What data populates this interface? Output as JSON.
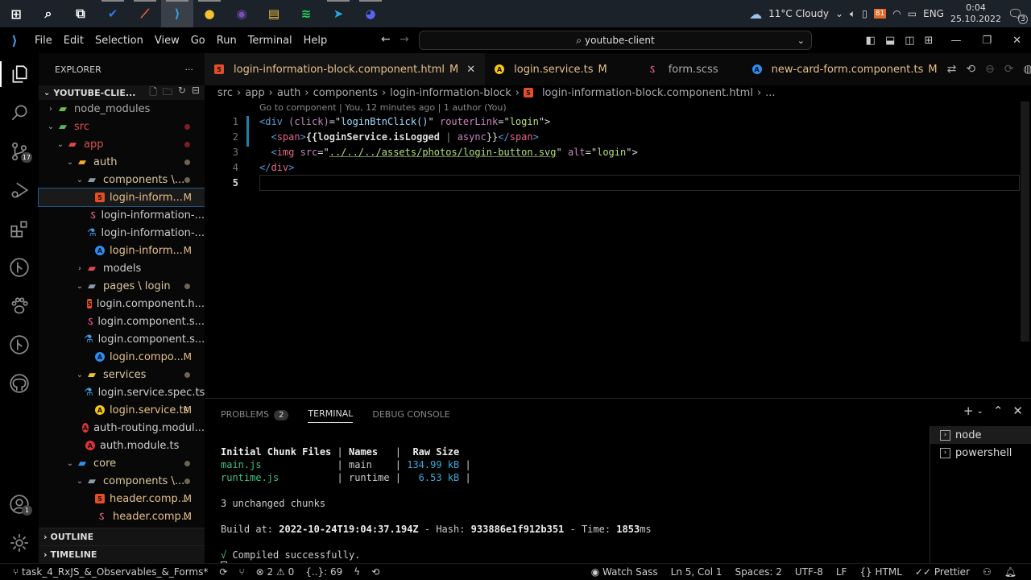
{
  "taskbar": {
    "apps": [
      {
        "name": "windows-start",
        "glyph": "⊞",
        "color": "#ffffff"
      },
      {
        "name": "search",
        "glyph": "⌕",
        "color": "#ffffff"
      },
      {
        "name": "task-view",
        "glyph": "⧉",
        "color": "#ffffff"
      },
      {
        "name": "todo",
        "glyph": "✔",
        "color": "#2a7de1"
      },
      {
        "name": "postman",
        "glyph": "⟋",
        "color": "#f26b3a"
      },
      {
        "name": "vscode",
        "glyph": "⟩",
        "color": "#3aa0f0"
      },
      {
        "name": "chrome",
        "glyph": "●",
        "color": "#f2c230"
      },
      {
        "name": "github-desktop",
        "glyph": "◉",
        "color": "#7a4fb5"
      },
      {
        "name": "file-explorer",
        "glyph": "▤",
        "color": "#f3c540"
      },
      {
        "name": "spotify",
        "glyph": "≋",
        "color": "#1ed760"
      },
      {
        "name": "telegram",
        "glyph": "➤",
        "color": "#2aa3df"
      },
      {
        "name": "discord",
        "glyph": "◕",
        "color": "#5865f2"
      }
    ],
    "weather": "11°C  Cloudy",
    "language": "ENG",
    "time": "0:04",
    "date": "25.10.2022",
    "notifications": "3",
    "battery_badge": "81"
  },
  "titlebar": {
    "menu": [
      "File",
      "Edit",
      "Selection",
      "View",
      "Go",
      "Run",
      "Terminal",
      "Help"
    ],
    "search": "youtube-client"
  },
  "activity_bar": {
    "source_control_badge": "17",
    "accounts_badge": "1"
  },
  "explorer": {
    "title": "EXPLORER",
    "more": "···",
    "project": "YOUTUBE-CLIE...",
    "tree": [
      {
        "label": "node_modules",
        "depth": 1,
        "chev": "›",
        "icon": "folder",
        "icolor": "#6cbf43",
        "tcolor": "#aaa"
      },
      {
        "label": "src",
        "depth": 1,
        "chev": "⌄",
        "icon": "folder",
        "icolor": "#58b35a",
        "tcolor": "#d8534f",
        "dot": "#7a1f24"
      },
      {
        "label": "app",
        "depth": 2,
        "chev": "⌄",
        "icon": "folder",
        "icolor": "#e0474c",
        "tcolor": "#d8534f",
        "dot": "#7a1f24"
      },
      {
        "label": "auth",
        "depth": 3,
        "chev": "⌄",
        "icon": "folder",
        "icolor": "#f0a72a",
        "tcolor": "#d9c8a0",
        "dot": "#6e6450"
      },
      {
        "label": "components \\...",
        "depth": 4,
        "chev": "⌄",
        "icon": "folder",
        "icolor": "#8a9aa8",
        "tcolor": "#d9c8a0",
        "dot": "#6e6450"
      },
      {
        "label": "login-inform...",
        "depth": 5,
        "icon": "html",
        "icolor": "#e44d26",
        "tcolor": "#e6c08a",
        "flag": "M",
        "selected": true
      },
      {
        "label": "login-information-...",
        "depth": 5,
        "icon": "scss",
        "icolor": "#e0568a",
        "tcolor": "#ccc"
      },
      {
        "label": "login-information-...",
        "depth": 5,
        "icon": "spec",
        "icolor": "#3d9be0",
        "tcolor": "#ccc"
      },
      {
        "label": "login-inform...",
        "depth": 5,
        "icon": "angular-blue",
        "icolor": "#2d8cf0",
        "tcolor": "#e6c08a",
        "flag": "M"
      },
      {
        "label": "models",
        "depth": 4,
        "chev": "›",
        "icon": "folder",
        "icolor": "#e0474c",
        "tcolor": "#ccc"
      },
      {
        "label": "pages \\ login",
        "depth": 4,
        "chev": "⌄",
        "icon": "folder",
        "icolor": "#8a9aa8",
        "tcolor": "#d9c8a0",
        "dot": "#6e6450"
      },
      {
        "label": "login.component.h...",
        "depth": 5,
        "icon": "html",
        "icolor": "#e44d26",
        "tcolor": "#ccc"
      },
      {
        "label": "login.component.s...",
        "depth": 5,
        "icon": "scss",
        "icolor": "#e0568a",
        "tcolor": "#ccc"
      },
      {
        "label": "login.component.s...",
        "depth": 5,
        "icon": "spec",
        "icolor": "#3d9be0",
        "tcolor": "#ccc"
      },
      {
        "label": "login.compo...",
        "depth": 5,
        "icon": "angular-blue",
        "icolor": "#2d8cf0",
        "tcolor": "#e6c08a",
        "flag": "M"
      },
      {
        "label": "services",
        "depth": 4,
        "chev": "⌄",
        "icon": "folder",
        "icolor": "#f0c030",
        "tcolor": "#d9c8a0",
        "dot": "#6e6450"
      },
      {
        "label": "login.service.spec.ts",
        "depth": 5,
        "icon": "spec",
        "icolor": "#3d9be0",
        "tcolor": "#ccc"
      },
      {
        "label": "login.service.ts",
        "depth": 5,
        "icon": "angular-yellow",
        "icolor": "#f5c518",
        "tcolor": "#e6c08a",
        "flag": "M"
      },
      {
        "label": "auth-routing.modul...",
        "depth": 4,
        "icon": "angular-red",
        "icolor": "#e0303a",
        "tcolor": "#ccc"
      },
      {
        "label": "auth.module.ts",
        "depth": 4,
        "icon": "angular-red",
        "icolor": "#e0303a",
        "tcolor": "#ccc"
      },
      {
        "label": "core",
        "depth": 3,
        "chev": "⌄",
        "icon": "folder",
        "icolor": "#3a8ee6",
        "tcolor": "#d9c8a0",
        "dot": "#6e6450"
      },
      {
        "label": "components \\...",
        "depth": 4,
        "chev": "⌄",
        "icon": "folder",
        "icolor": "#8a9aa8",
        "tcolor": "#d9c8a0",
        "dot": "#6e6450"
      },
      {
        "label": "header.comp...",
        "depth": 5,
        "icon": "html",
        "icolor": "#e44d26",
        "tcolor": "#e6c08a",
        "flag": "M"
      },
      {
        "label": "header.comp...",
        "depth": 5,
        "icon": "scss",
        "icolor": "#e0568a",
        "tcolor": "#e6c08a",
        "flag": "M"
      }
    ],
    "outline": "OUTLINE",
    "timeline": "TIMELINE"
  },
  "tabs": [
    {
      "label": "login-information-block.component.html",
      "flag": "M",
      "icon": "html",
      "icolor": "#e44d26",
      "tcolor": "#e6c08a",
      "active": true,
      "close": "✕"
    },
    {
      "label": "login.service.ts",
      "flag": "M",
      "icon": "angular-yellow",
      "icolor": "#f5c518",
      "tcolor": "#e6c08a"
    },
    {
      "label": "form.scss",
      "flag": "",
      "icon": "scss",
      "icolor": "#e0568a",
      "tcolor": "#aaa"
    },
    {
      "label": "new-card-form.component.ts",
      "flag": "M",
      "icon": "angular-blue",
      "icolor": "#2d8cf0",
      "tcolor": "#e6c08a"
    }
  ],
  "breadcrumb": [
    "src",
    "app",
    "auth",
    "components",
    "login-information-block",
    "login-information-block.component.html",
    "..."
  ],
  "editor": {
    "codelens": "Go to component | You, 12 minutes ago | 1 author (You)",
    "line_numbers": [
      "1",
      "2",
      "3",
      "4",
      "5"
    ],
    "lines": {
      "l1": {
        "a": "<div ",
        "b": "(click)",
        "c": "=\"",
        "d": "loginBtnClick()",
        "e": "\" ",
        "f": "routerLink",
        "g": "=\"",
        "h": "login",
        "i": "\">"
      },
      "l2": {
        "a": "  <",
        "b": "span",
        "c": ">",
        "d": "{{loginService.isLogged",
        "e": " | ",
        "f": "async",
        "g": "}}",
        "h": "</",
        "i": "span",
        "j": ">"
      },
      "l3": {
        "a": "  <",
        "b": "img ",
        "c": "src",
        "d": "=\"",
        "e": "../../../assets/photos/login-button.svg",
        "f": "\" ",
        "g": "alt",
        "h": "=\"",
        "i": "login",
        "j": "\">"
      },
      "l4": {
        "a": "</",
        "b": "div",
        "c": ">"
      }
    }
  },
  "panel": {
    "tabs": [
      {
        "label": "PROBLEMS",
        "badge": "2"
      },
      {
        "label": "TERMINAL",
        "active": true
      },
      {
        "label": "DEBUG CONSOLE"
      }
    ],
    "terminal": {
      "header": {
        "c1": "Initial Chunk Files",
        "sep": " | ",
        "c2": "Names  ",
        "sep2": " | ",
        "c3": " Raw Size"
      },
      "rows": [
        {
          "file": "main.js            ",
          "name": "main   ",
          "size": "134.99 kB"
        },
        {
          "file": "runtime.js         ",
          "name": "runtime",
          "size": "  6.53 kB"
        }
      ],
      "unchanged": "3 unchanged chunks",
      "build_label": "Build at: ",
      "build_time": "2022-10-24T19:04:37.194Z",
      "hash_label": " - Hash: ",
      "hash": "933886e1f912b351",
      "time_label": " - Time: ",
      "time": "1853",
      "time_unit": "ms",
      "check": "√",
      "compiled": " Compiled successfully."
    },
    "terminals": [
      "node",
      "powershell"
    ]
  },
  "statusbar": {
    "branch": "task_4_RxJS_&_Observables_&_Forms*",
    "errors": "2",
    "warnings": "0",
    "lines_info": "{..}: 69",
    "watch_sass": "Watch Sass",
    "cursor": "Ln 5, Col 1",
    "spaces": "Spaces: 2",
    "encoding": "UTF-8",
    "eol": "LF",
    "language": "HTML",
    "formatter": "Prettier"
  }
}
